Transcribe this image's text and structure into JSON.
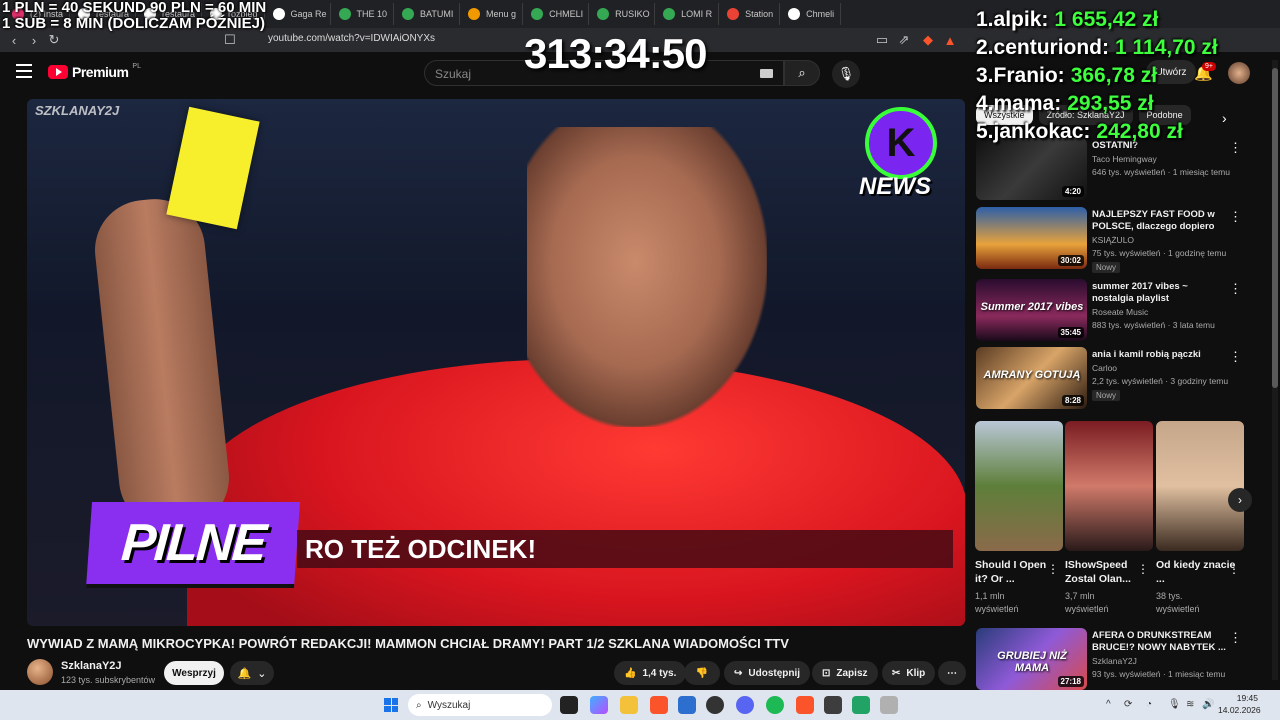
{
  "browser": {
    "tabs": [
      {
        "label": "(2) Insta",
        "color": "#e1306c"
      },
      {
        "label": "restaura",
        "color": "#ffffff"
      },
      {
        "label": "restaura",
        "color": "#ffffff"
      },
      {
        "label": "rozbieg",
        "color": "#ffffff"
      },
      {
        "label": "Gaga Re",
        "color": "#ffffff"
      },
      {
        "label": "THE 10",
        "color": "#34a853"
      },
      {
        "label": "BATUMI",
        "color": "#34a853"
      },
      {
        "label": "Menu g",
        "color": "#f29900"
      },
      {
        "label": "CHMELI",
        "color": "#34a853"
      },
      {
        "label": "RUSIKO",
        "color": "#34a853"
      },
      {
        "label": "LOMI R",
        "color": "#34a853"
      },
      {
        "label": "Station",
        "color": "#ea4335"
      },
      {
        "label": "Chmeli",
        "color": "#ffffff"
      }
    ],
    "url": "youtube.com/watch?v=IDWIAiONYXs"
  },
  "overlay": {
    "rate_line1": "1 PLN =  40 SEKUND 90 PLN = 60 MIN",
    "rate_line2": "1 SUB = 8 MIN (DOLICZAM PÓŹNIEJ)",
    "timer": "313:34:50",
    "leaderboard": [
      {
        "rank_name": "1.alpik:",
        "amount": "1 655,42 zł"
      },
      {
        "rank_name": "2.centuriond:",
        "amount": "1 114,70 zł"
      },
      {
        "rank_name": "3.Franio:",
        "amount": "366,78 zł"
      },
      {
        "rank_name": "4.mama:",
        "amount": "293,55 zł"
      },
      {
        "rank_name": "5.jankokac:",
        "amount": "242,80 zł"
      }
    ]
  },
  "youtube": {
    "logo_word": "Premium",
    "logo_region": "PL",
    "search_placeholder": "Szukaj",
    "notification_count": "9+",
    "create_label": "Utwórz"
  },
  "video": {
    "watermark": "SZKLANAY2J",
    "news_logo_text": "NEWS",
    "lower_badge": "PILNE",
    "lower_bar": "RO TEŻ ODCINEK!",
    "title": "WYWIAD Z MAMĄ MIKROCYPKA! POWRÓT REDAKCJI! MAMMON CHCIAŁ DRAMY! PART 1/2 SZKLANA WIADOMOŚCI TTV",
    "channel_name": "SzklanaY2J",
    "channel_subs": "123 tys. subskrybentów",
    "support_label": "Wesprzyj",
    "likes": "1,4 tys.",
    "share_label": "Udostępnij",
    "save_label": "Zapisz",
    "clip_label": "Klip"
  },
  "sidebar": {
    "chips": [
      "Wszystkie",
      "Źródło: SzklanaY2J",
      "Podobne"
    ],
    "recommendations": [
      {
        "title": "OSTATNI?",
        "channel": "Taco Hemingway",
        "meta": "646 tys. wyświetleń · 1 miesiąc temu",
        "duration": "4:20",
        "badge": ""
      },
      {
        "title": "NAJLEPSZY FAST FOOD w POLSCE, dlaczego dopiero ter...",
        "channel": "KSIĄŻULO",
        "meta": "75 tys. wyświetleń · 1 godzinę temu",
        "duration": "30:02",
        "badge": "Nowy"
      },
      {
        "title": "summer 2017 vibes ~ nostalgia playlist",
        "channel": "Roseate Music",
        "meta": "883 tys. wyświetleń · 3 lata temu",
        "duration": "35:45",
        "badge": "",
        "thumb_text": "Summer 2017 vibes"
      },
      {
        "title": "ania i kamil robią pączki",
        "channel": "Carloo",
        "meta": "2,2 tys. wyświetleń · 3 godziny temu",
        "duration": "8:28",
        "badge": "Nowy",
        "thumb_text": "AMRANY GOTUJĄ"
      },
      {
        "title": "AFERA O DRUNKSTREAM BRUCE!? NOWY NABYTEK ...",
        "channel": "SzklanaY2J",
        "meta": "93 tys. wyświetleń · 1 miesiąc temu",
        "duration": "27:18",
        "badge": "",
        "thumb_text": "GRUBIEJ NIŻ MAMA"
      }
    ],
    "shorts": [
      {
        "title": "Should I Open it? Or ...",
        "views_line1": "1,1 mln",
        "views_line2": "wyświetleń"
      },
      {
        "title": "IShowSpeed Zostal Olan...",
        "views_line1": "3,7 mln",
        "views_line2": "wyświetleń"
      },
      {
        "title": "Od kiedy znacie ...",
        "views_line1": "38 tys.",
        "views_line2": "wyświetleń"
      }
    ]
  },
  "taskbar": {
    "search_placeholder": "Wyszukaj",
    "time": "19:45",
    "date": "14.02.2026"
  }
}
